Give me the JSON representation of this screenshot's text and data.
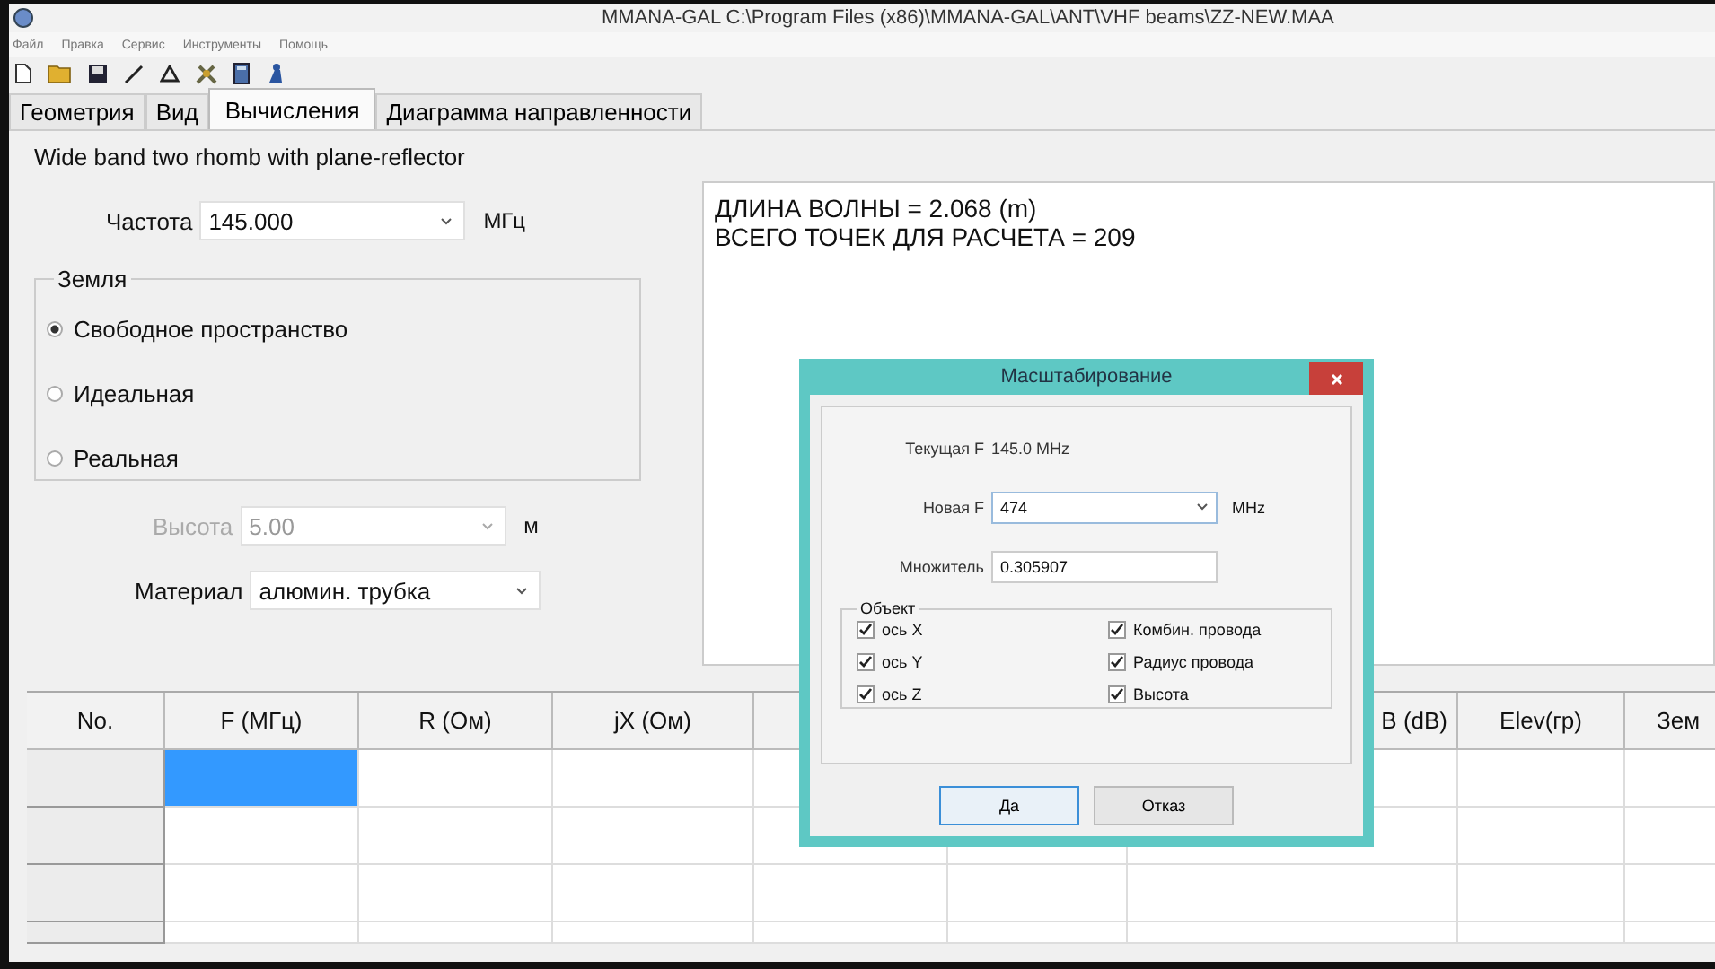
{
  "window": {
    "title": "MMANA-GAL C:\\Program Files (x86)\\MMANA-GAL\\ANT\\VHF beams\\ZZ-NEW.MAA"
  },
  "menu": [
    "Файл",
    "Правка",
    "Сервис",
    "Инструменты",
    "Помощь"
  ],
  "tabs": [
    {
      "label": "Геометрия",
      "selected": false
    },
    {
      "label": "Вид",
      "selected": false
    },
    {
      "label": "Вычисления",
      "selected": true
    },
    {
      "label": "Диаграмма направленности",
      "selected": false
    }
  ],
  "antenna_name": "Wide band two rhomb with plane-reflector",
  "frequency": {
    "label": "Частота",
    "value": "145.000",
    "unit": "МГц"
  },
  "ground": {
    "title": "Земля",
    "options": [
      {
        "label": "Свободное пространство",
        "selected": true
      },
      {
        "label": "Идеальная",
        "selected": false
      },
      {
        "label": "Реальная",
        "selected": false
      }
    ]
  },
  "height": {
    "label": "Высота",
    "value": "5.00",
    "unit": "м",
    "disabled": true
  },
  "material": {
    "label": "Материал",
    "value": "алюмин. трубка"
  },
  "output": [
    "ДЛИНА ВОЛНЫ = 2.068 (m)",
    "ВСЕГО ТОЧЕК ДЛЯ РАСЧЕТА = 209"
  ],
  "table": {
    "columns": [
      {
        "label": "No."
      },
      {
        "label": "F (МГц)"
      },
      {
        "label": "R (Ом)"
      },
      {
        "label": "jX (Ом)"
      },
      {},
      {},
      {
        "label": "B (dB)"
      },
      {
        "label": "Elev(гр)"
      },
      {
        "label": "Зем"
      }
    ],
    "rows": [
      {
        "selected": true
      },
      {
        "selected": false
      },
      {
        "selected": false
      },
      {
        "selected": false
      }
    ]
  },
  "dialog": {
    "title": "Масштабирование",
    "current": {
      "label": "Текущая F",
      "value": "145.0 MHz"
    },
    "new": {
      "label": "Новая F",
      "value": "474",
      "unit": "MHz"
    },
    "factor": {
      "label": "Множитель",
      "value": "0.305907"
    },
    "object": {
      "title": "Объект",
      "options": [
        {
          "label": "ось X",
          "checked": true
        },
        {
          "label": "Комбин. провода",
          "checked": true
        },
        {
          "label": "ось Y",
          "checked": true
        },
        {
          "label": "Радиус провода",
          "checked": true
        },
        {
          "label": "ось Z",
          "checked": true
        },
        {
          "label": "Высота",
          "checked": true
        }
      ]
    },
    "buttons": [
      "Да",
      "Отказ"
    ]
  }
}
